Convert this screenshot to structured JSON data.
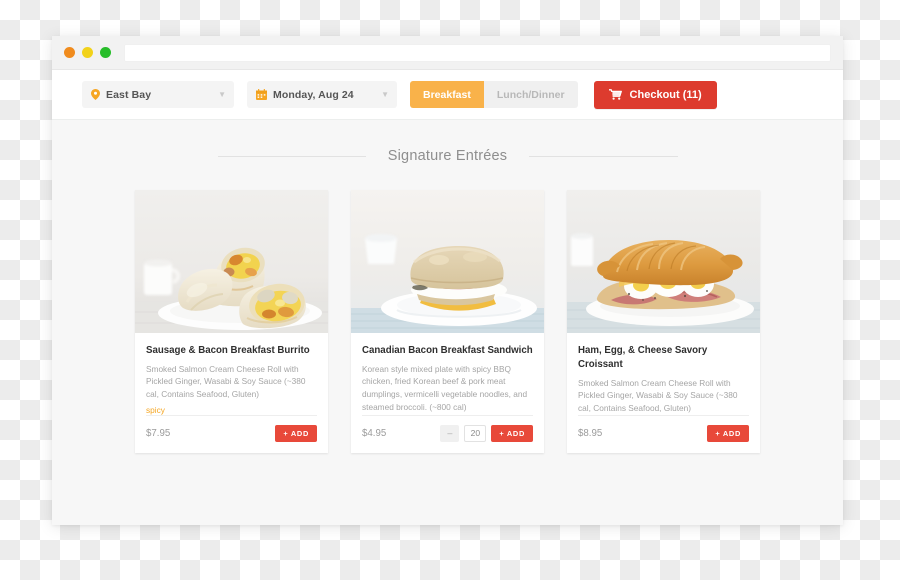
{
  "window": {
    "traffic_lights": [
      "close",
      "minimize",
      "maximize"
    ],
    "address_value": "",
    "address_placeholder": ""
  },
  "toolbar": {
    "location": {
      "icon": "location-pin-icon",
      "value": "East Bay"
    },
    "date": {
      "icon": "calendar-icon",
      "value": "Monday, Aug 24"
    },
    "meal_tabs": [
      {
        "label": "Breakfast",
        "active": true
      },
      {
        "label": "Lunch/Dinner",
        "active": false
      }
    ],
    "checkout": {
      "icon": "shopping-cart-icon",
      "label": "Checkout (11)",
      "count": 11
    }
  },
  "main": {
    "section_title": "Signature Entrées",
    "cards": [
      {
        "image": "sausage-bacon-breakfast-burrito-photo",
        "title": "Sausage & Bacon Breakfast Burrito",
        "description": "Smoked Salmon Cream Cheese Roll with Pickled Ginger, Wasabi & Soy Sauce (~380 cal, Contains Seafood, Gluten)",
        "tag": "spicy",
        "price": "$7.95",
        "add_label": "+ ADD",
        "has_quantity": false,
        "quantity": ""
      },
      {
        "image": "canadian-bacon-breakfast-sandwich-photo",
        "title": "Canadian Bacon Breakfast Sandwich",
        "description": "Korean style mixed plate with spicy BBQ chicken, fried Korean beef & pork meat dumplings, vermicelli vegetable noodles, and steamed broccoli. (~800 cal)",
        "tag": "",
        "price": "$4.95",
        "add_label": "+ ADD",
        "has_quantity": true,
        "quantity": "20",
        "minus_label": "–"
      },
      {
        "image": "ham-egg-cheese-savory-croissant-photo",
        "title": "Ham, Egg, & Cheese Savory Croissant",
        "description": "Smoked Salmon Cream Cheese Roll with Pickled Ginger, Wasabi & Soy Sauce (~380 cal, Contains Seafood, Gluten)",
        "tag": "",
        "price": "$8.95",
        "add_label": "+ ADD",
        "has_quantity": false,
        "quantity": ""
      }
    ]
  },
  "colors": {
    "accent_orange": "#f9b24a",
    "accent_red": "#dd3b2e",
    "add_red": "#e8493a",
    "tag_orange": "#f5a623",
    "page_bg": "#f7f7f7",
    "muted_text": "#a5a5a5"
  }
}
